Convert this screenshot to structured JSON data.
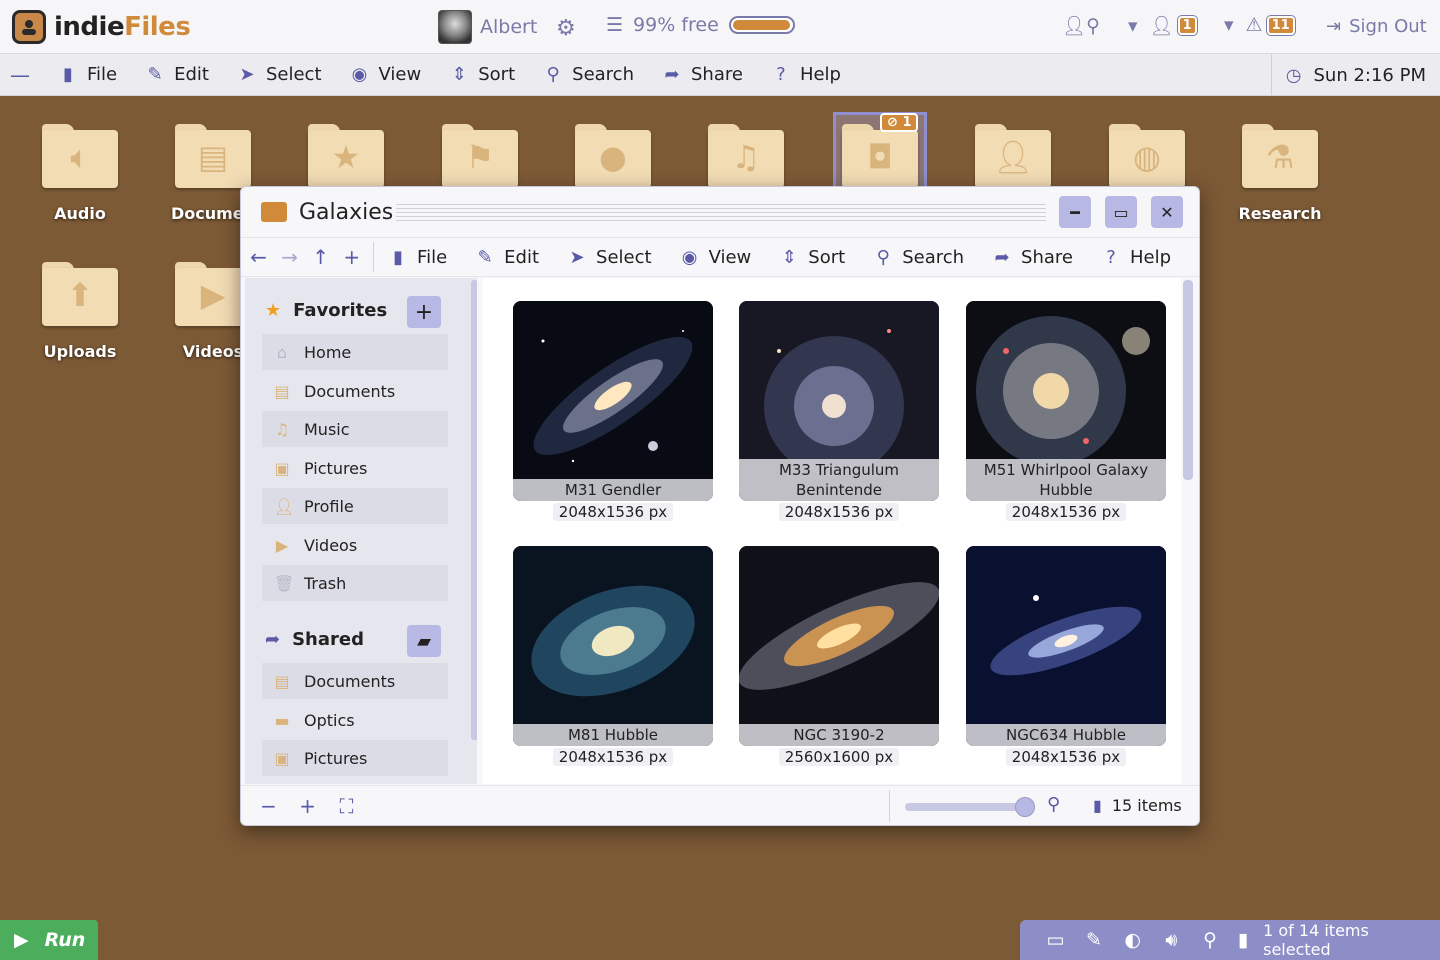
{
  "app": {
    "logo_text_1": "indie",
    "logo_text_2": "Files"
  },
  "header": {
    "user_name": "Albert",
    "storage_text": "99% free",
    "storage_fraction": 0.99,
    "notifications_count": "1",
    "alerts_count": "11",
    "sign_out_label": "Sign Out"
  },
  "menubar": {
    "items": [
      "File",
      "Edit",
      "Select",
      "View",
      "Sort",
      "Search",
      "Share",
      "Help"
    ],
    "clock": "Sun 2:16 PM"
  },
  "desktop": {
    "icons": [
      "Audio",
      "Documents",
      "",
      "",
      "",
      "",
      "",
      "",
      "",
      "Research",
      "Uploads",
      "Videos"
    ],
    "label_audio": "Audio",
    "label_documents": "Documen",
    "label_research": "Research",
    "label_uploads": "Uploads",
    "label_videos": "Videos",
    "selected_link_count": "1"
  },
  "window": {
    "title": "Galaxies",
    "toolbar": [
      "File",
      "Edit",
      "Select",
      "View",
      "Sort",
      "Search",
      "Share",
      "Help"
    ],
    "sidebar": {
      "favorites_label": "Favorites",
      "favorites": [
        "Home",
        "Documents",
        "Music",
        "Pictures",
        "Profile",
        "Videos",
        "Trash"
      ],
      "shared_label": "Shared",
      "shared": [
        "Documents",
        "Optics",
        "Pictures"
      ]
    },
    "items": [
      {
        "name": "M31 Gendler",
        "size": "2048x1536 px"
      },
      {
        "name": "M33 Triangulum Benintende",
        "size": "2048x1536 px"
      },
      {
        "name": "M51 Whirlpool Galaxy Hubble",
        "size": "2048x1536 px"
      },
      {
        "name": "M81 Hubble",
        "size": "2048x1536 px"
      },
      {
        "name": "NGC 3190-2",
        "size": "2560x1600 px"
      },
      {
        "name": "NGC634 Hubble",
        "size": "2048x1536 px"
      }
    ],
    "status": {
      "count": "15 items",
      "zoom_fraction": 0.9
    }
  },
  "taskbar": {
    "run_label": "Run",
    "selection_text": "1 of 14 items selected"
  },
  "colors": {
    "accent": "#d08a3a",
    "ui": "#7a7aa8",
    "desktop": "#7d5a36",
    "run": "#4cae5c"
  }
}
